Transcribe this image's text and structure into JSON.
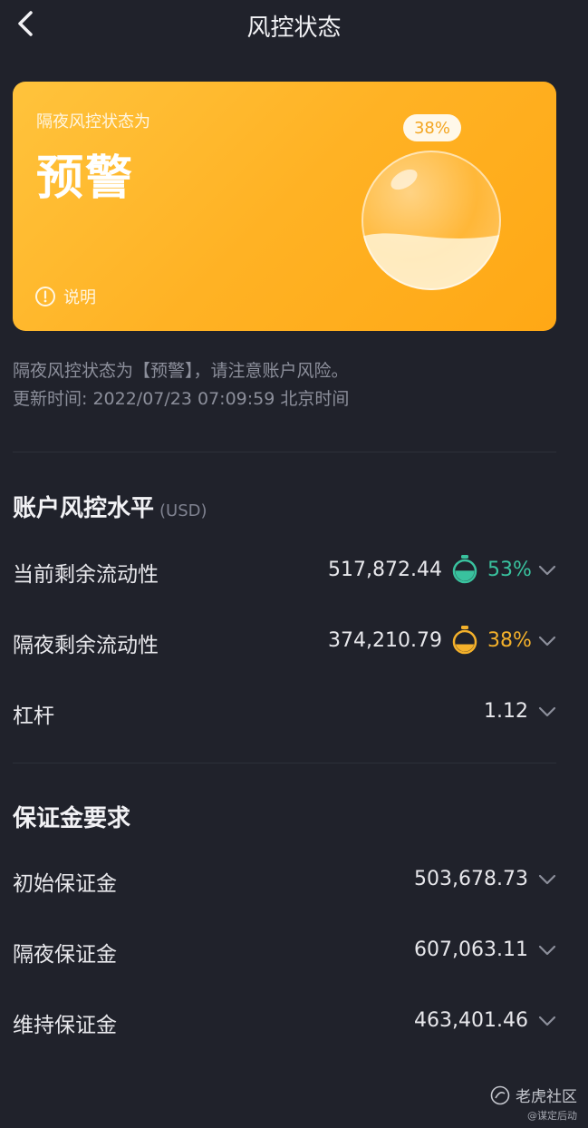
{
  "header": {
    "title": "风控状态"
  },
  "card": {
    "subtitle": "隔夜风控状态为",
    "status": "预警",
    "info_label": "说明",
    "percent": "38%",
    "fill_fraction": 0.38
  },
  "description": {
    "line1": "隔夜风控状态为【预警】，请注意账户风险。",
    "line2": "更新时间: 2022/07/23 07:09:59 北京时间"
  },
  "risk_section": {
    "title": "账户风控水平",
    "unit": "(USD)",
    "rows": [
      {
        "label": "当前剩余流动性",
        "value": "517,872.44",
        "percent": "53%",
        "fill_fraction": 0.53,
        "color": "#39c29e"
      },
      {
        "label": "隔夜剩余流动性",
        "value": "374,210.79",
        "percent": "38%",
        "fill_fraction": 0.38,
        "color": "#f4b12b"
      },
      {
        "label": "杠杆",
        "value": "1.12"
      }
    ]
  },
  "margin_section": {
    "title": "保证金要求",
    "rows": [
      {
        "label": "初始保证金",
        "value": "503,678.73"
      },
      {
        "label": "隔夜保证金",
        "value": "607,063.11"
      },
      {
        "label": "维持保证金",
        "value": "463,401.46"
      }
    ]
  },
  "footer": {
    "brand": "老虎社区",
    "handle": "@谋定后动"
  }
}
